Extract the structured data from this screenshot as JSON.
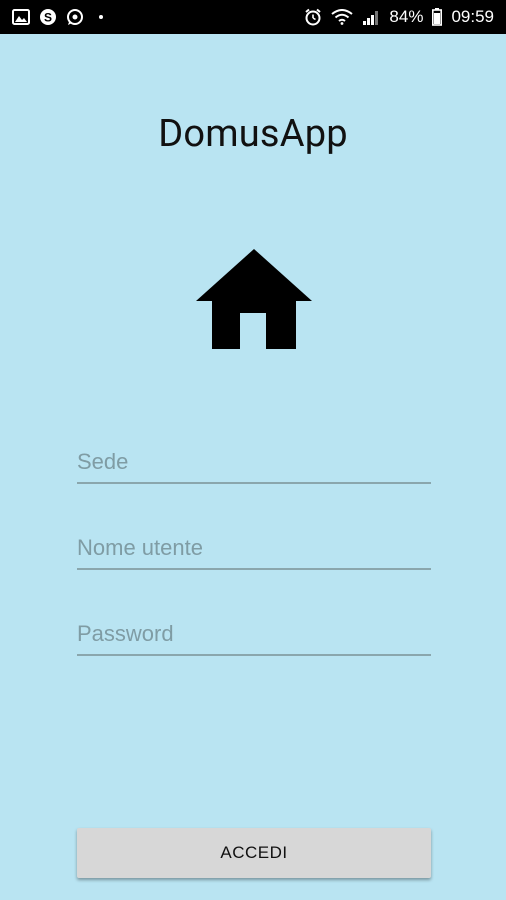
{
  "status_bar": {
    "left_icons": [
      "gallery-icon",
      "skype-icon",
      "whatsapp-icon",
      "notification-dot-icon"
    ],
    "right_icons": [
      "alarm-icon",
      "wifi-icon",
      "signal-icon",
      "battery-icon"
    ],
    "battery": "84%",
    "time": "09:59"
  },
  "app": {
    "title": "DomusApp",
    "logo_icon": "home-icon"
  },
  "form": {
    "sede_placeholder": "Sede",
    "username_placeholder": "Nome utente",
    "password_placeholder": "Password",
    "submit_label": "ACCEDI"
  },
  "colors": {
    "background": "#b9e4f2",
    "status_bar": "#000000",
    "button": "#d7d7d7",
    "underline": "#8aa6ad"
  }
}
